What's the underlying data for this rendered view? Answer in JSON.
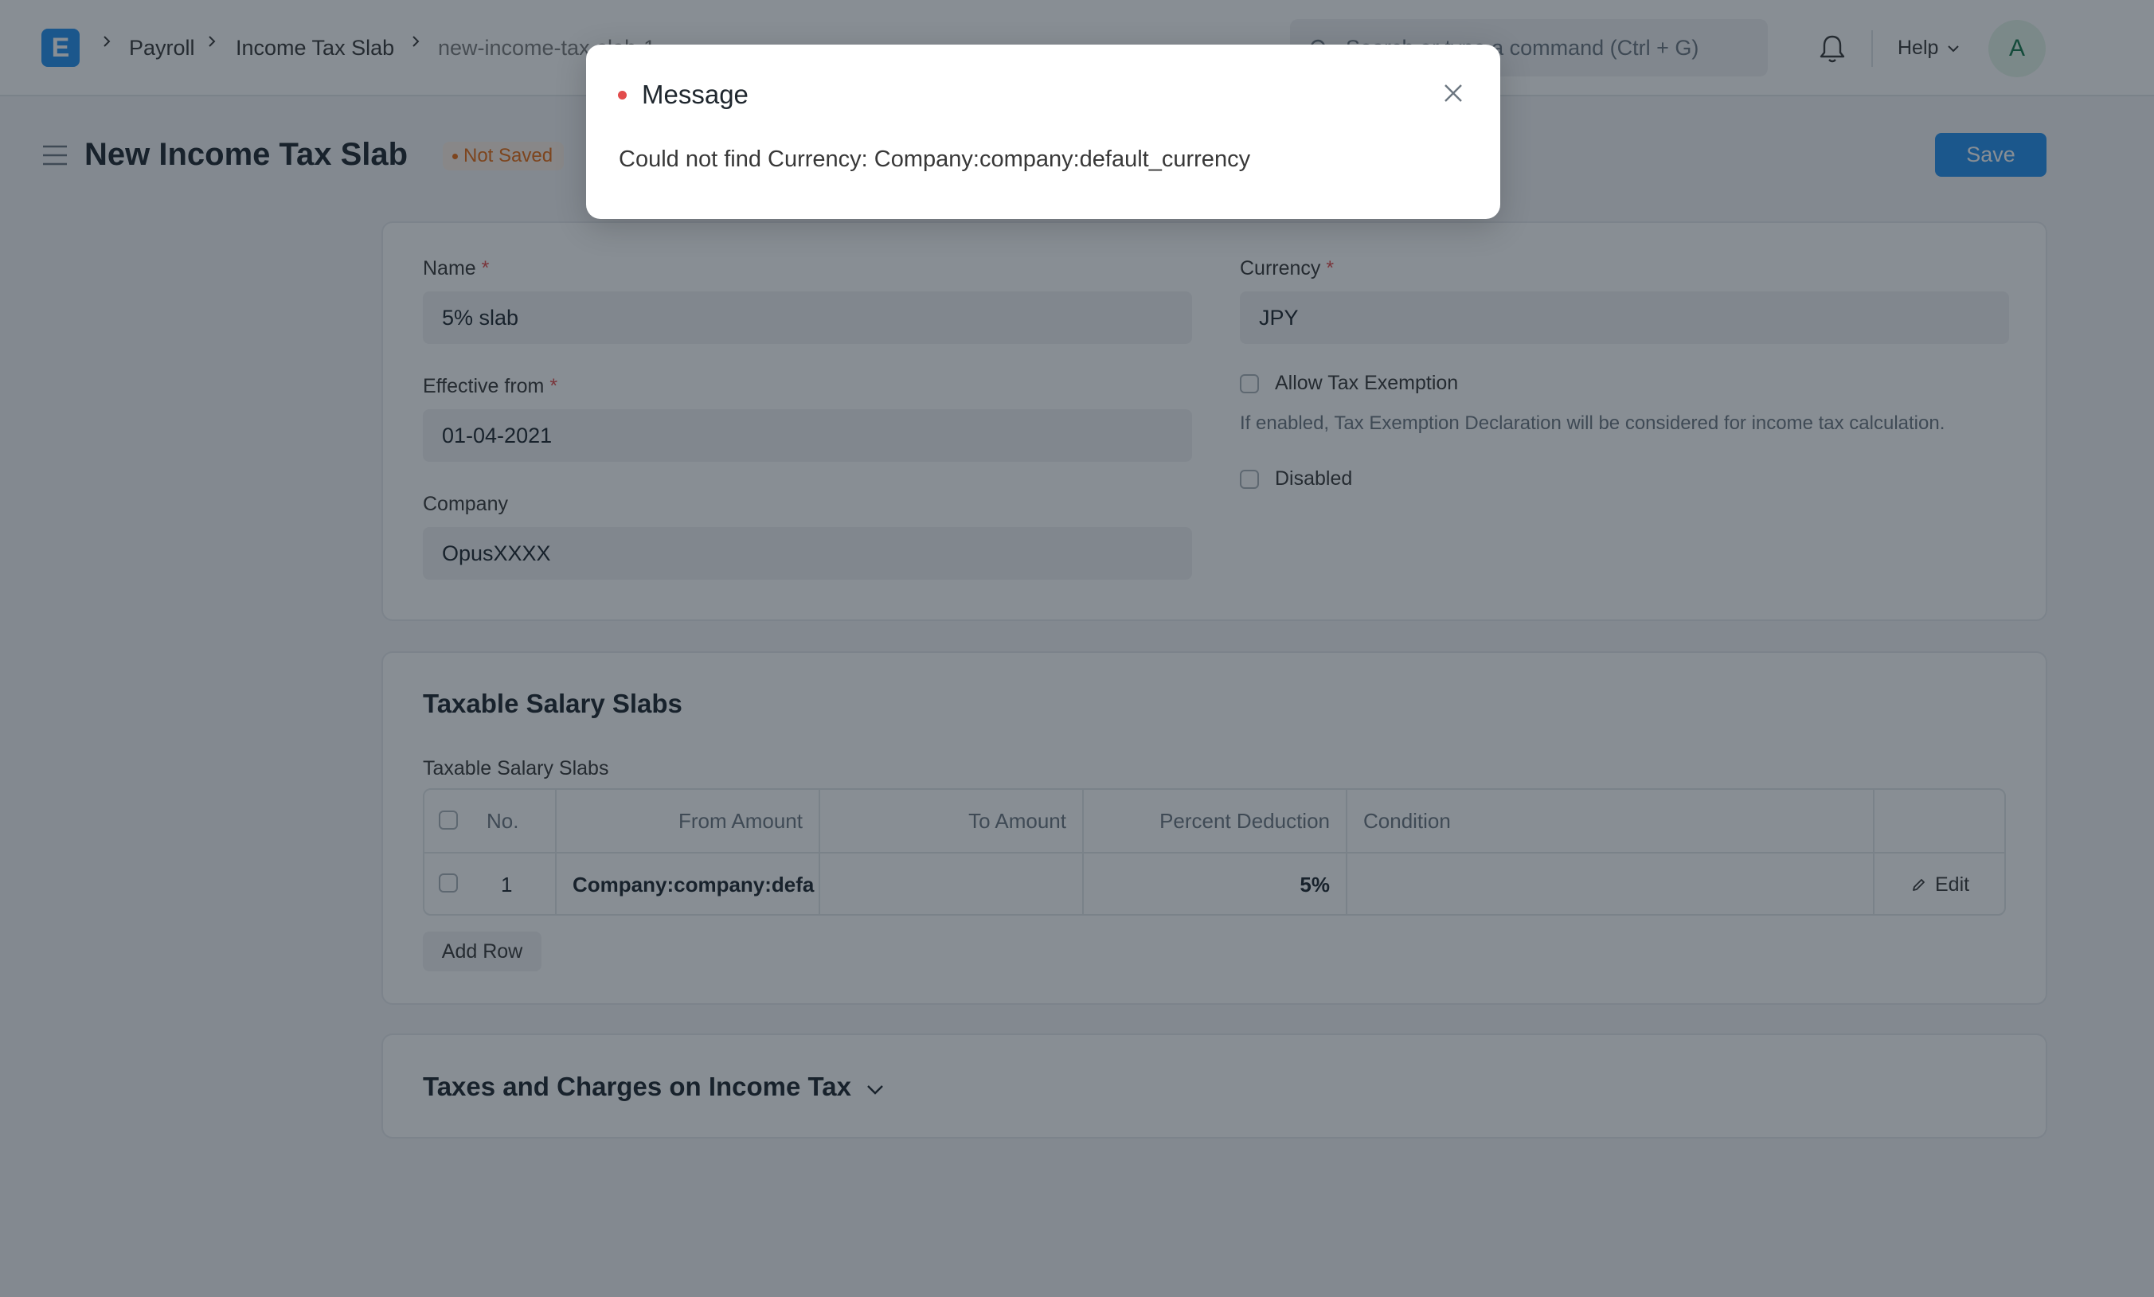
{
  "navbar": {
    "logo_letter": "E",
    "breadcrumbs": [
      "Payroll",
      "Income Tax Slab",
      "new-income-tax-slab-1"
    ],
    "search_placeholder": "Search or type a command (Ctrl + G)",
    "help_label": "Help",
    "avatar_initial": "A"
  },
  "page": {
    "title": "New Income Tax Slab",
    "status": "Not Saved",
    "save_label": "Save"
  },
  "form": {
    "name_label": "Name",
    "name_value": "5% slab",
    "effective_label": "Effective from",
    "effective_value": "01-04-2021",
    "company_label": "Company",
    "company_value": "OpusXXXX",
    "currency_label": "Currency",
    "currency_value": "JPY",
    "allow_exemption_label": "Allow Tax Exemption",
    "allow_exemption_desc": "If enabled, Tax Exemption Declaration will be considered for income tax calculation.",
    "disabled_label": "Disabled",
    "required_mark": "*"
  },
  "slabs": {
    "section_title": "Taxable Salary Slabs",
    "table_label": "Taxable Salary Slabs",
    "columns": [
      "No.",
      "From Amount",
      "To Amount",
      "Percent Deduction",
      "Condition"
    ],
    "rows": [
      {
        "no": "1",
        "from_amount": "Company:company:defa",
        "to_amount": "",
        "percent_deduction": "5%",
        "condition": ""
      }
    ],
    "edit_label": "Edit",
    "add_row_label": "Add Row"
  },
  "taxes_section": {
    "title": "Taxes and Charges on Income Tax"
  },
  "modal": {
    "title": "Message",
    "body": "Could not find Currency: Company:company:default_currency",
    "indicator_color": "#e24c4c"
  },
  "colors": {
    "primary": "#2490ef",
    "not_saved": "#e86c13",
    "overlay": "rgba(18,30,42,0.5)"
  }
}
